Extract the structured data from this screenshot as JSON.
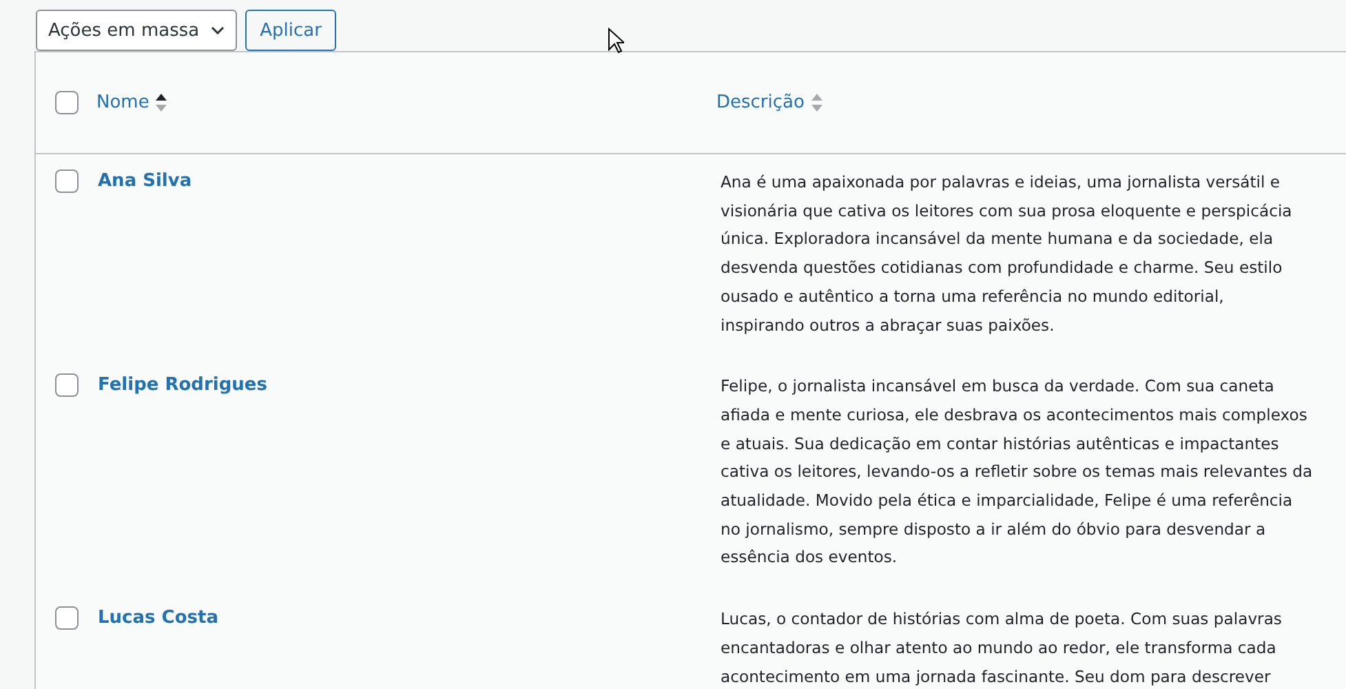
{
  "toolbar": {
    "bulk_actions": "Ações em massa",
    "apply": "Aplicar"
  },
  "table": {
    "select_all": {
      "checked": false
    },
    "columns": [
      {
        "label": "Nome",
        "sorted": true
      },
      {
        "label": "Descrição",
        "sorted": false
      }
    ],
    "rows": [
      {
        "checked": false,
        "name": "Ana Silva",
        "description": "Ana é uma apaixonada por palavras e ideias, uma jornalista versátil e\nvisionária que cativa os leitores com sua prosa eloquente e perspicácia\núnica. Exploradora incansável da mente humana e da sociedade, ela\ndesvenda questões cotidianas com profundidade e charme. Seu estilo\nousado e autêntico a torna uma referência no mundo editorial,\ninspirando outros a abraçar suas paixões."
      },
      {
        "checked": false,
        "name": "Felipe Rodrigues",
        "description": "Felipe, o jornalista incansável em busca da verdade. Com sua caneta\nafiada e mente curiosa, ele desbrava os acontecimentos mais complexos\ne atuais. Sua dedicação em contar histórias autênticas e impactantes\ncativa os leitores, levando-os a refletir sobre os temas mais relevantes da\natualidade. Movido pela ética e imparcialidade, Felipe é uma referência\nno jornalismo, sempre disposto a ir além do óbvio para desvendar a\nessência dos eventos."
      },
      {
        "checked": false,
        "name": "Lucas Costa",
        "description": "Lucas, o contador de histórias com alma de poeta. Com suas palavras\nencantadoras e olhar atento ao mundo ao redor, ele transforma cada\nacontecimento em uma jornada fascinante. Seu dom para descrever"
      }
    ]
  }
}
